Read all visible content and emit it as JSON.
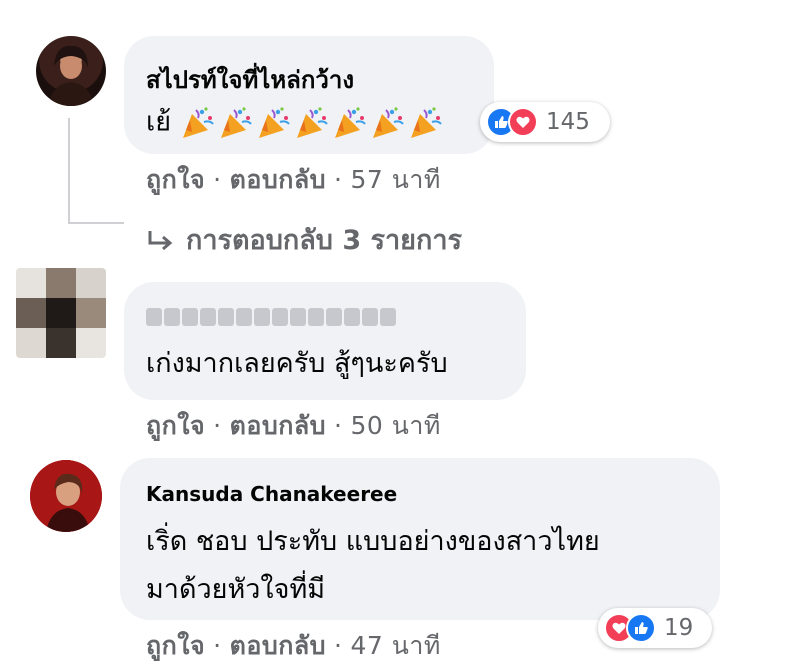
{
  "comments": [
    {
      "author": "สไปรท์ใจที่ไหล่กว้าง",
      "text": "เย้",
      "emoji": "party-popper-icon",
      "emoji_count": 7,
      "reactions": {
        "count": "145",
        "types": [
          "like",
          "love"
        ]
      },
      "actions": {
        "like": "ถูกใจ",
        "reply": "ตอบกลับ",
        "time": "57 นาที"
      },
      "replies_link": "การตอบกลับ 3 รายการ"
    },
    {
      "author": "",
      "author_blurred": true,
      "text": "เก่งมากเลยครับ สู้ๆนะครับ",
      "actions": {
        "like": "ถูกใจ",
        "reply": "ตอบกลับ",
        "time": "50 นาที"
      }
    },
    {
      "author": "Kansuda Chanakeeree",
      "text_lines": [
        "เริ่ด ชอบ ประทับ แบบอย่างของสาวไทย",
        "มาด้วยหัวใจที่มี"
      ],
      "reactions": {
        "count": "19",
        "types": [
          "love",
          "like"
        ]
      },
      "actions": {
        "like": "ถูกใจ",
        "reply": "ตอบกลับ",
        "time": "47 นาที"
      }
    }
  ],
  "colors": {
    "like": "#1877f2",
    "love": "#f33e58",
    "bubble": "#f0f2f5",
    "meta": "#65676b"
  }
}
